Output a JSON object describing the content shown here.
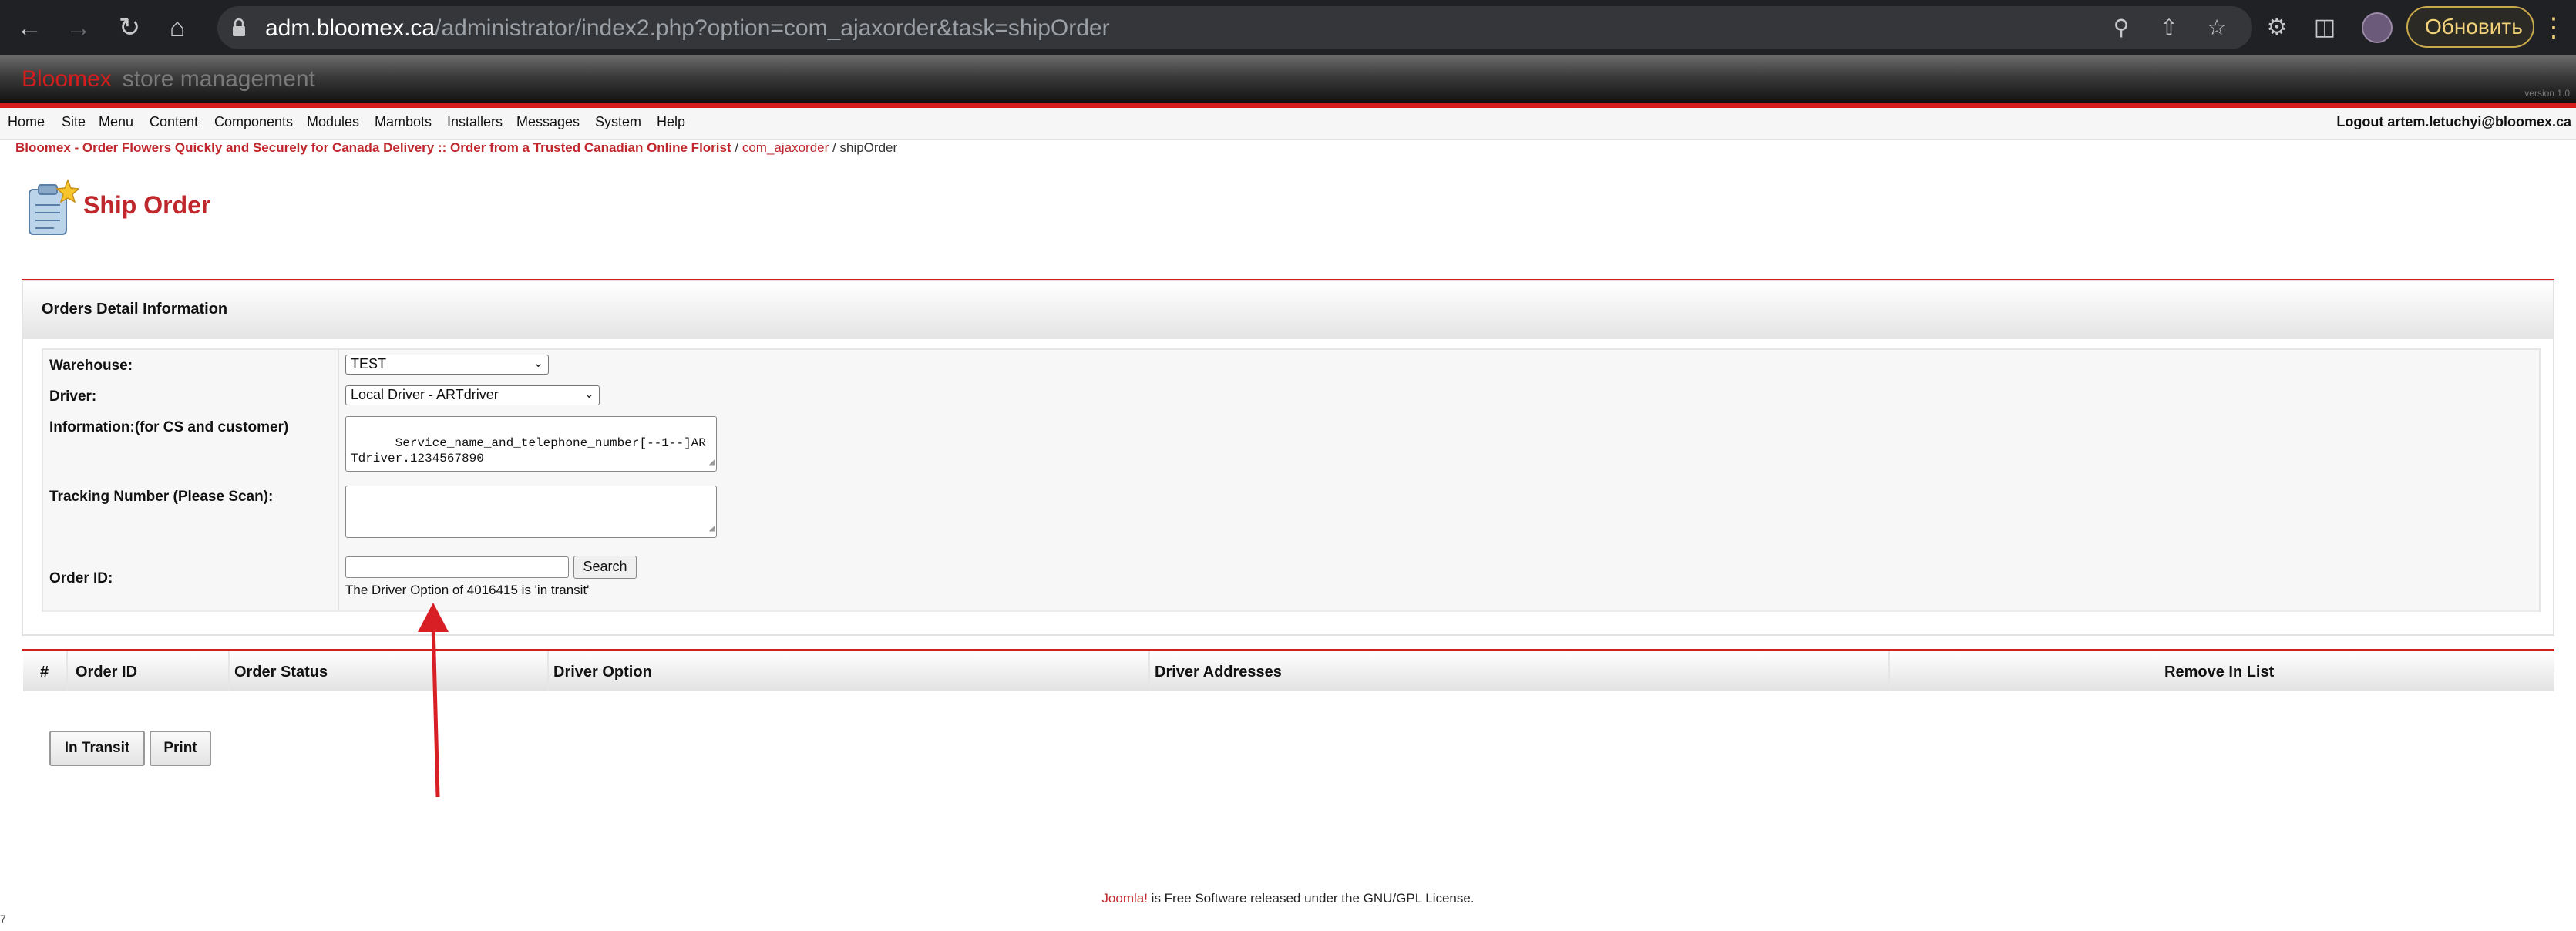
{
  "browser": {
    "url_host": "adm.bloomex.ca",
    "url_path": "/administrator/index2.php?option=com_ajaxorder&task=shipOrder",
    "update_label": "Обновить"
  },
  "header": {
    "brand_name": "Bloomex",
    "brand_sub": "store management",
    "version": "version 1.0"
  },
  "menu": {
    "items": [
      "Home",
      "Site",
      "Menu",
      "Content",
      "Components",
      "Modules",
      "Mambots",
      "Installers",
      "Messages",
      "System",
      "Help"
    ],
    "logout": "Logout artem.letuchyi@bloomex.ca"
  },
  "breadcrumb": {
    "site": "Bloomex - Order Flowers Quickly and Securely for Canada Delivery :: Order from a Trusted Canadian Online Florist",
    "component": "com_ajaxorder",
    "current": "shipOrder",
    "separator": "/"
  },
  "page": {
    "title": "Ship Order"
  },
  "panel": {
    "title": "Orders Detail Information",
    "warehouse_label": "Warehouse:",
    "warehouse_value": "TEST",
    "driver_label": "Driver:",
    "driver_value": "Local Driver - ARTdriver",
    "info_label": "Information:(for CS and customer)",
    "info_value": "Service_name_and_telephone_number[--1--]ARTdriver.1234567890",
    "tracking_label": "Tracking Number (Please Scan):",
    "tracking_value": "",
    "order_id_label": "Order ID:",
    "order_id_value": "",
    "search_label": "Search",
    "driver_message": "The Driver Option of 4016415 is 'in transit'"
  },
  "table": {
    "headers": [
      "#",
      "Order ID",
      "Order Status",
      "Driver Option",
      "Driver Addresses",
      "Remove In List"
    ]
  },
  "actions": {
    "in_transit": "In Transit",
    "print": "Print"
  },
  "footer": {
    "joomla": "Joomla!",
    "text": " is Free Software released under the GNU/GPL License."
  },
  "misc": {
    "corner_number": "7"
  },
  "colors": {
    "accent_red": "#c0272d",
    "annotation_arrow": "#d81f26"
  }
}
